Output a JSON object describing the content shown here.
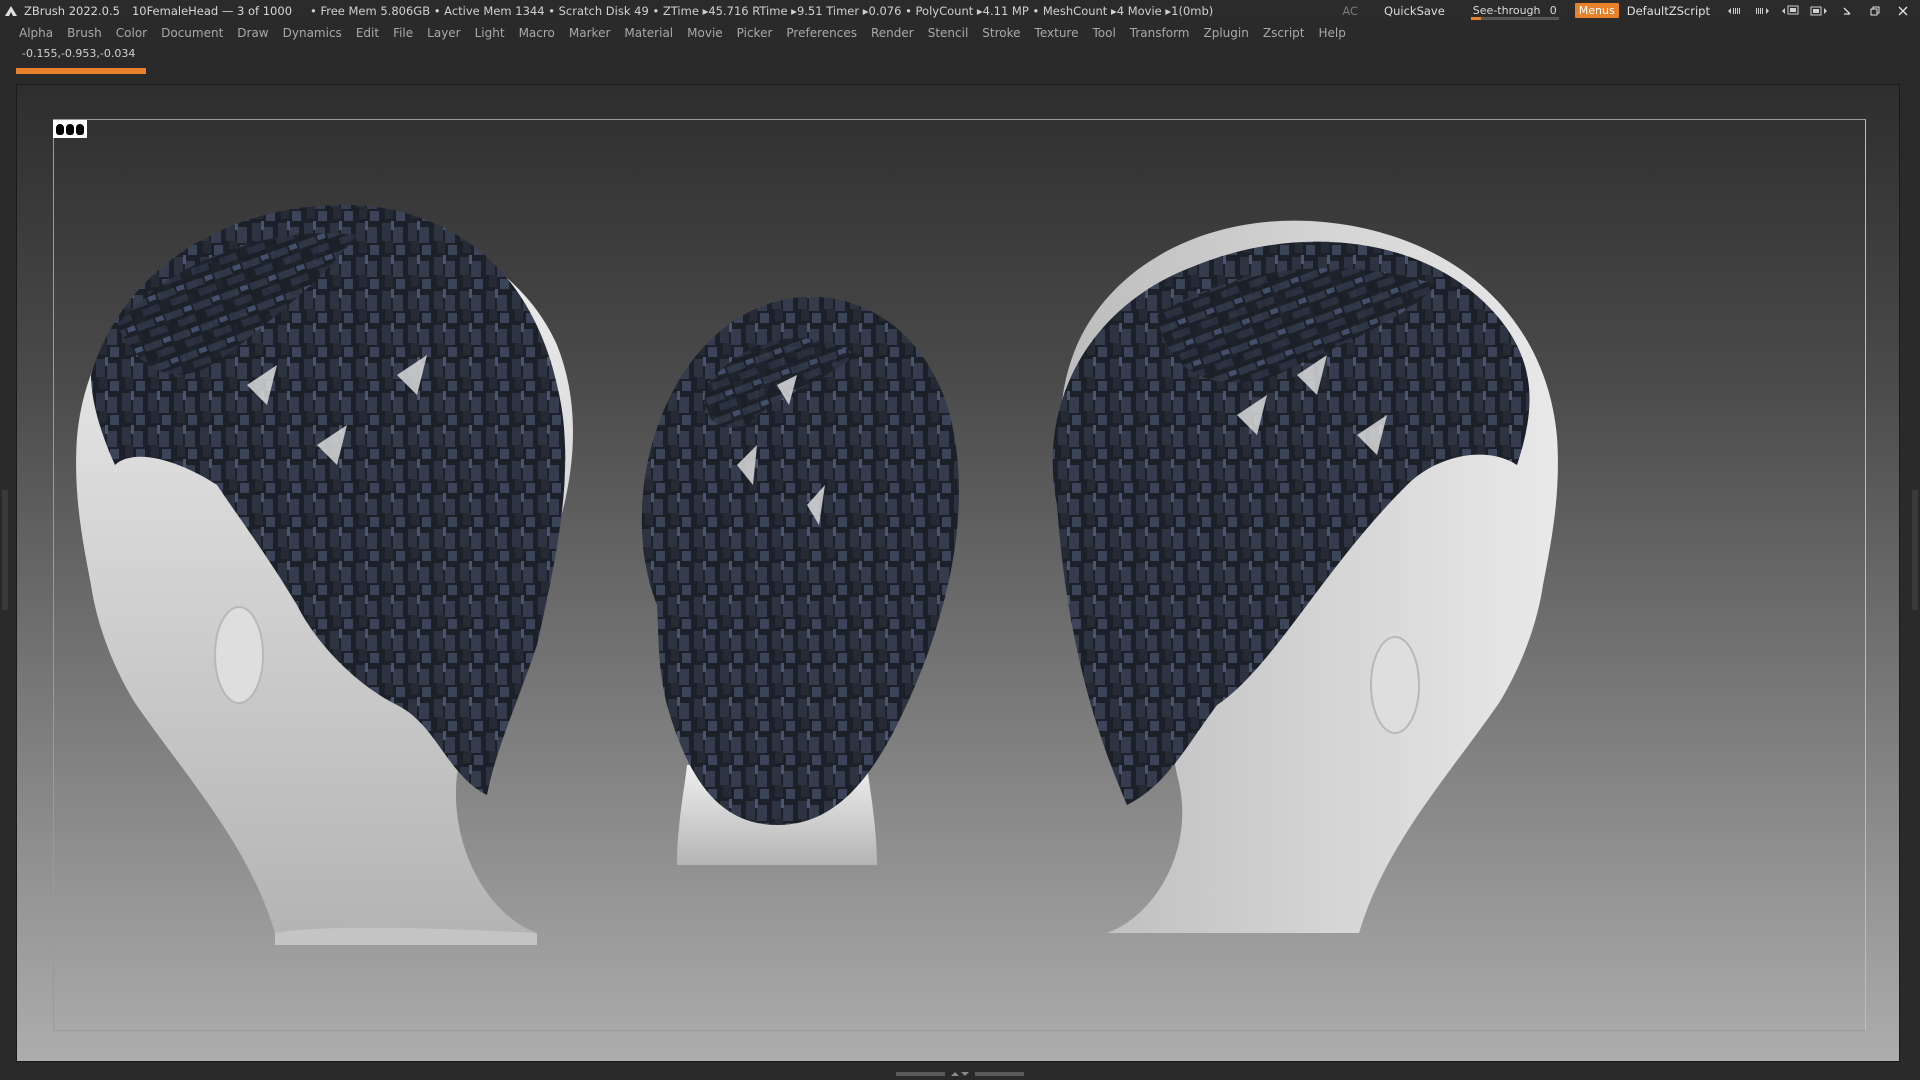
{
  "titlebar": {
    "app": "ZBrush 2022.0.5",
    "document": "10FemaleHead — 3 of 1000",
    "stats": "• Free Mem 5.806GB • Active Mem 1344 • Scratch Disk 49 • ZTime ▸45.716 RTime ▸9.51 Timer ▸0.076 • PolyCount ▸4.11 MP • MeshCount ▸4  Movie ▸1(0mb)",
    "ac": "AC",
    "quicksave": "QuickSave",
    "see_through_label": "See-through",
    "see_through_value": "0",
    "see_through_level": 0.12,
    "menus": "Menus",
    "script": "DefaultZScript"
  },
  "menubar": {
    "items": [
      "Alpha",
      "Brush",
      "Color",
      "Document",
      "Draw",
      "Dynamics",
      "Edit",
      "File",
      "Layer",
      "Light",
      "Macro",
      "Marker",
      "Material",
      "Movie",
      "Picker",
      "Preferences",
      "Render",
      "Stencil",
      "Stroke",
      "Texture",
      "Tool",
      "Transform",
      "Zplugin",
      "Zscript",
      "Help"
    ]
  },
  "info": {
    "coordinates": "-0.155,-0.953,-0.034",
    "progress": 1.0
  },
  "colors": {
    "accent": "#e8822a",
    "panel": "#2a2a2a",
    "hair": "#1e2430",
    "skin": "#d6d6d6"
  },
  "icons": [
    "zbrush-logo-icon",
    "store-icon",
    "layout-icon",
    "window-restore-icon",
    "minimize-icon",
    "maximize-icon",
    "close-icon"
  ]
}
